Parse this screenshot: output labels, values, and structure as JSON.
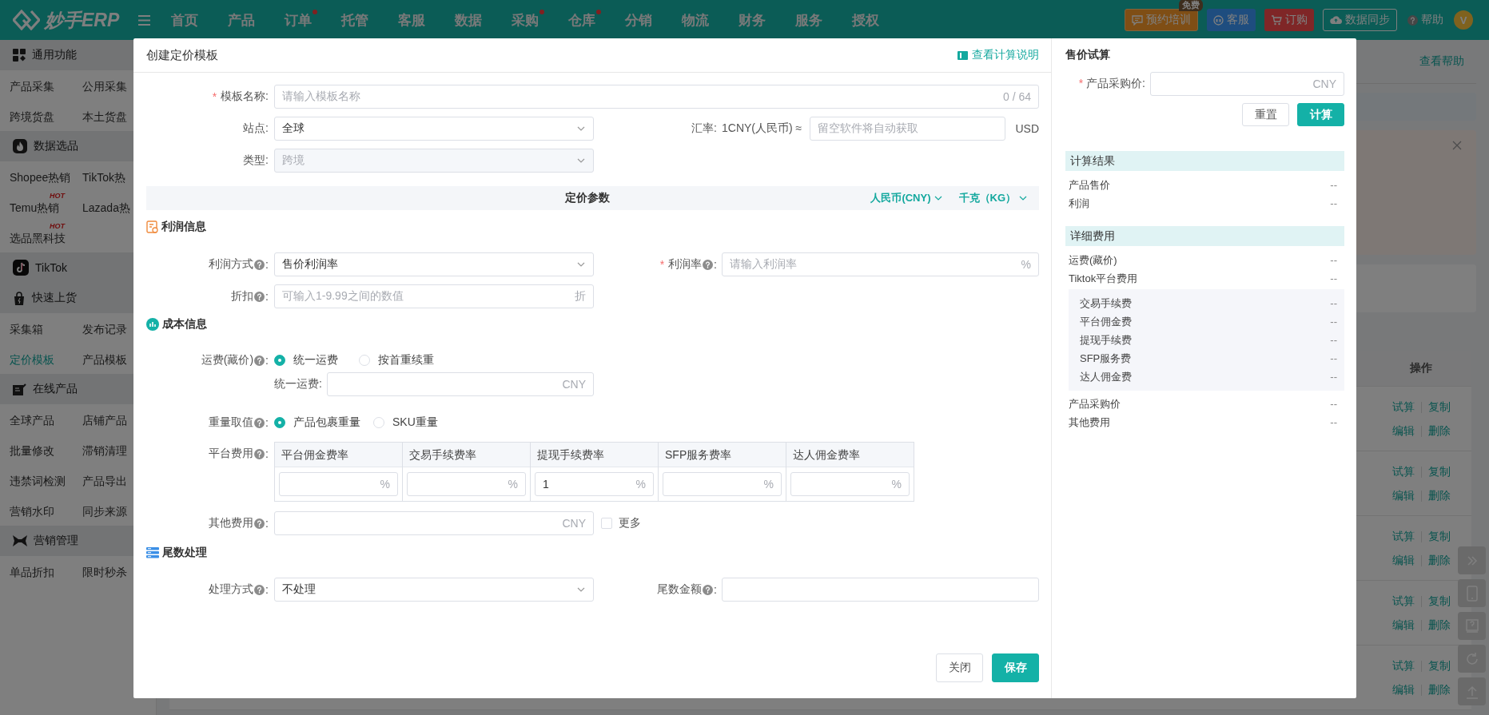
{
  "header": {
    "logo": "妙手ERP",
    "nav": [
      {
        "label": "首页",
        "dot": false
      },
      {
        "label": "产品",
        "dot": false
      },
      {
        "label": "订单",
        "dot": true
      },
      {
        "label": "托管",
        "dot": false
      },
      {
        "label": "客服",
        "dot": false
      },
      {
        "label": "数据",
        "dot": false
      },
      {
        "label": "采购",
        "dot": true
      },
      {
        "label": "仓库",
        "dot": true
      },
      {
        "label": "分销",
        "dot": false
      },
      {
        "label": "物流",
        "dot": false
      },
      {
        "label": "财务",
        "dot": false
      },
      {
        "label": "服务",
        "dot": false
      },
      {
        "label": "授权",
        "dot": false
      }
    ],
    "actions": [
      {
        "kind": "training",
        "label": "预约培训",
        "badge": "免费"
      },
      {
        "kind": "service",
        "label": "客服"
      },
      {
        "kind": "order",
        "label": "订购"
      },
      {
        "kind": "sync",
        "label": "数据同步"
      },
      {
        "kind": "help",
        "label": "帮助"
      }
    ],
    "avatar": "V"
  },
  "sidebar": [
    {
      "title": "通用功能",
      "items": [
        {
          "label": "产品采集",
          "selected": false
        },
        {
          "label": "公用采集",
          "selected": false
        },
        {
          "label": "跨境货盘",
          "selected": false
        },
        {
          "label": "本土货盘",
          "selected": false
        }
      ]
    },
    {
      "title": "数据选品",
      "items": [
        {
          "label": "Shopee热销",
          "selected": false
        },
        {
          "label": "TikTok热",
          "selected": false
        },
        {
          "label": "Temu热销",
          "selected": false,
          "badge": "HOT"
        },
        {
          "label": "Lazada热",
          "selected": false
        },
        {
          "label": "选品黑科技",
          "selected": false,
          "badge": "HOT"
        }
      ]
    },
    {
      "title": "TikTok"
    },
    {
      "title": "快速上货",
      "items": [
        {
          "label": "采集箱",
          "selected": false
        },
        {
          "label": "发布记录",
          "selected": false
        },
        {
          "label": "定价模板",
          "selected": true
        },
        {
          "label": "产品模板",
          "selected": false
        }
      ]
    },
    {
      "title": "在线产品",
      "items": [
        {
          "label": "全球产品",
          "selected": false
        },
        {
          "label": "店铺产品",
          "selected": false
        },
        {
          "label": "批量修改",
          "selected": false
        },
        {
          "label": "滞销清理",
          "selected": false
        },
        {
          "label": "违禁词检测",
          "selected": false
        },
        {
          "label": "产品导出",
          "selected": false
        },
        {
          "label": "营销水印",
          "selected": false
        },
        {
          "label": "同步来源",
          "selected": false
        }
      ]
    },
    {
      "title": "营销管理",
      "items": [
        {
          "label": "单品折扣",
          "selected": false
        },
        {
          "label": "限时秒杀",
          "selected": false
        }
      ]
    }
  ],
  "page": {
    "help_link": "查看帮助",
    "table": {
      "action_header": "操作",
      "rows": [
        {
          "actions": [
            "试算",
            "复制",
            "编辑",
            "删除"
          ]
        },
        {
          "actions": [
            "试算",
            "复制",
            "编辑",
            "删除"
          ]
        },
        {
          "actions": [
            "试算",
            "复制",
            "编辑",
            "删除"
          ]
        },
        {
          "actions": [
            "试算",
            "复制",
            "编辑",
            "删除"
          ]
        },
        {
          "actions": [
            "试算",
            "复制",
            "编辑",
            "删除"
          ]
        }
      ]
    }
  },
  "modal": {
    "title": "创建定价模板",
    "guide_link": "查看计算说明",
    "basic": {
      "name": {
        "required_mark": "*",
        "label": "模板名称:",
        "placeholder": "请输入模板名称",
        "counter": "0 / 64"
      },
      "site": {
        "label": "站点:",
        "value": "全球"
      },
      "rate": {
        "label": "汇率:",
        "prefix": "1CNY(人民币) ≈",
        "placeholder": "留空软件将自动获取",
        "suffix": "USD"
      },
      "type": {
        "label": "类型:",
        "value": "跨境",
        "disabled": true
      }
    },
    "params_bar": {
      "title": "定价参数",
      "currency": "人民币(CNY)",
      "unit": "千克（KG）"
    },
    "profit": {
      "title": "利润信息",
      "method": {
        "label": "利润方式",
        "help": true,
        "colon": ":",
        "value": "售价利润率"
      },
      "rate": {
        "required_mark": "*",
        "label": "利润率",
        "help": true,
        "colon": ":",
        "placeholder": "请输入利润率",
        "suffix": "%"
      },
      "discount": {
        "label": "折扣",
        "help": true,
        "colon": ":",
        "placeholder": "可输入1-9.99之间的数值",
        "suffix": "折"
      }
    },
    "cost": {
      "title": "成本信息",
      "shipping": {
        "label": "运费(藏价)",
        "help": true,
        "colon": ":",
        "options": [
          {
            "label": "统一运费",
            "selected": true
          },
          {
            "label": "按首重续重",
            "selected": false
          }
        ]
      },
      "flat_fee": {
        "label": "统一运费:",
        "suffix": "CNY"
      },
      "weight": {
        "label": "重量取值",
        "help": true,
        "colon": ":",
        "options": [
          {
            "label": "产品包裹重量",
            "selected": true
          },
          {
            "label": "SKU重量",
            "selected": false
          }
        ]
      },
      "platform_fees": {
        "label": "平台费用",
        "help": true,
        "colon": ":",
        "columns": [
          {
            "header": "平台佣金费率",
            "suffix": "%"
          },
          {
            "header": "交易手续费率",
            "suffix": "%"
          },
          {
            "header": "提现手续费率",
            "value": "1",
            "suffix": "%"
          },
          {
            "header": "SFP服务费率",
            "suffix": "%"
          },
          {
            "header": "达人佣金费率",
            "suffix": "%"
          }
        ]
      },
      "other": {
        "label": "其他费用",
        "help": true,
        "colon": ":",
        "suffix": "CNY",
        "more": {
          "label": "更多",
          "checked": false
        }
      }
    },
    "rounding": {
      "title": "尾数处理",
      "method": {
        "label": "处理方式",
        "help": true,
        "colon": ":",
        "value": "不处理"
      },
      "amount": {
        "label": "尾数金额",
        "help": true,
        "colon": ":"
      }
    },
    "buttons": {
      "close": "关闭",
      "save": "保存"
    },
    "trial": {
      "title": "售价试算",
      "price": {
        "required_mark": "*",
        "label": "产品采购价:",
        "suffix": "CNY"
      },
      "reset": "重置",
      "calc": "计算",
      "groups": [
        {
          "title": "计算结果",
          "rows": [
            {
              "label": "产品售价",
              "value": "--"
            },
            {
              "label": "利润",
              "value": "--"
            }
          ]
        },
        {
          "title": "详细费用",
          "rows": [
            {
              "label": "运费(藏价)",
              "value": "--"
            },
            {
              "label": "Tiktok平台费用",
              "value": "--",
              "children": [
                {
                  "label": "交易手续费",
                  "value": "--"
                },
                {
                  "label": "平台佣金费",
                  "value": "--"
                },
                {
                  "label": "提现手续费",
                  "value": "--"
                },
                {
                  "label": "SFP服务费",
                  "value": "--"
                },
                {
                  "label": "达人佣金费",
                  "value": "--"
                }
              ]
            },
            {
              "label": "产品采购价",
              "value": "--"
            },
            {
              "label": "其他费用",
              "value": "--"
            }
          ]
        }
      ]
    }
  }
}
